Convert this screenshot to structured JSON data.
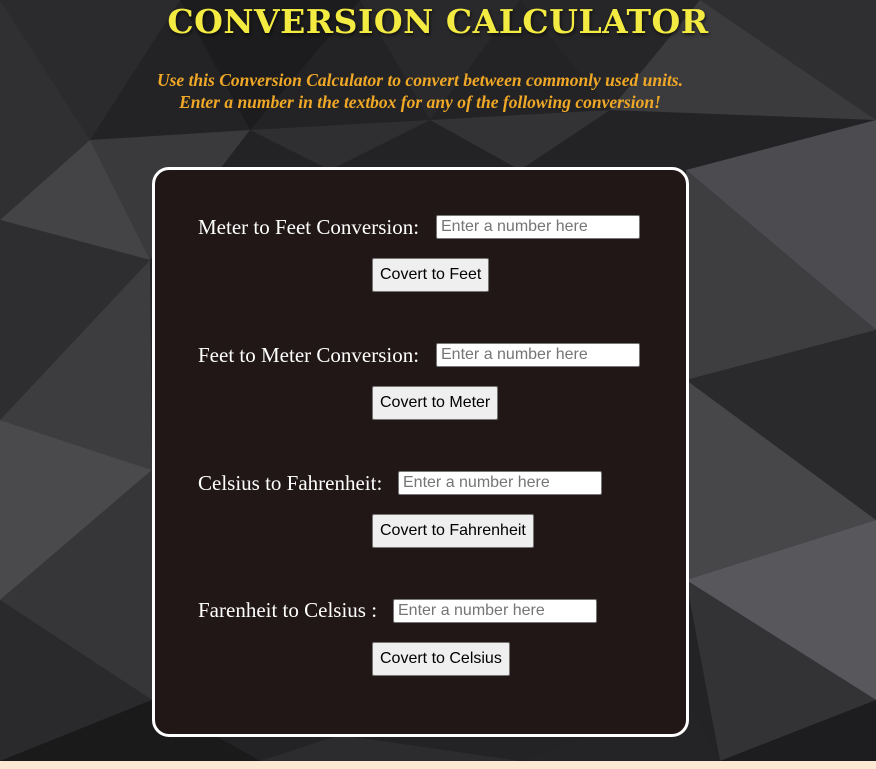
{
  "header": {
    "title": "CONVERSION CALCULATOR",
    "subtitle_line1": "Use this Conversion Calculator to convert between commonly used units.",
    "subtitle_line2": "Enter a number in the textbox for any of the following conversion!"
  },
  "conversions": [
    {
      "label": "Meter to Feet Conversion:",
      "placeholder": "Enter a number here",
      "value": "",
      "button": "Covert to Feet"
    },
    {
      "label": "Feet to Meter Conversion:",
      "placeholder": "Enter a number here",
      "value": "",
      "button": "Covert to Meter"
    },
    {
      "label": "Celsius to Fahrenheit:",
      "placeholder": "Enter a number here",
      "value": "",
      "button": "Covert to Fahrenheit"
    },
    {
      "label": "Farenheit to Celsius :",
      "placeholder": "Enter a number here",
      "value": "",
      "button": "Covert to Celsius"
    }
  ],
  "colors": {
    "title": "#f3ea42",
    "subtitle": "#f0a826",
    "panel_background": "#201716",
    "panel_border": "#ffffff",
    "page_background": "#1e1e20"
  },
  "background_image": "dark-polygon-pattern"
}
